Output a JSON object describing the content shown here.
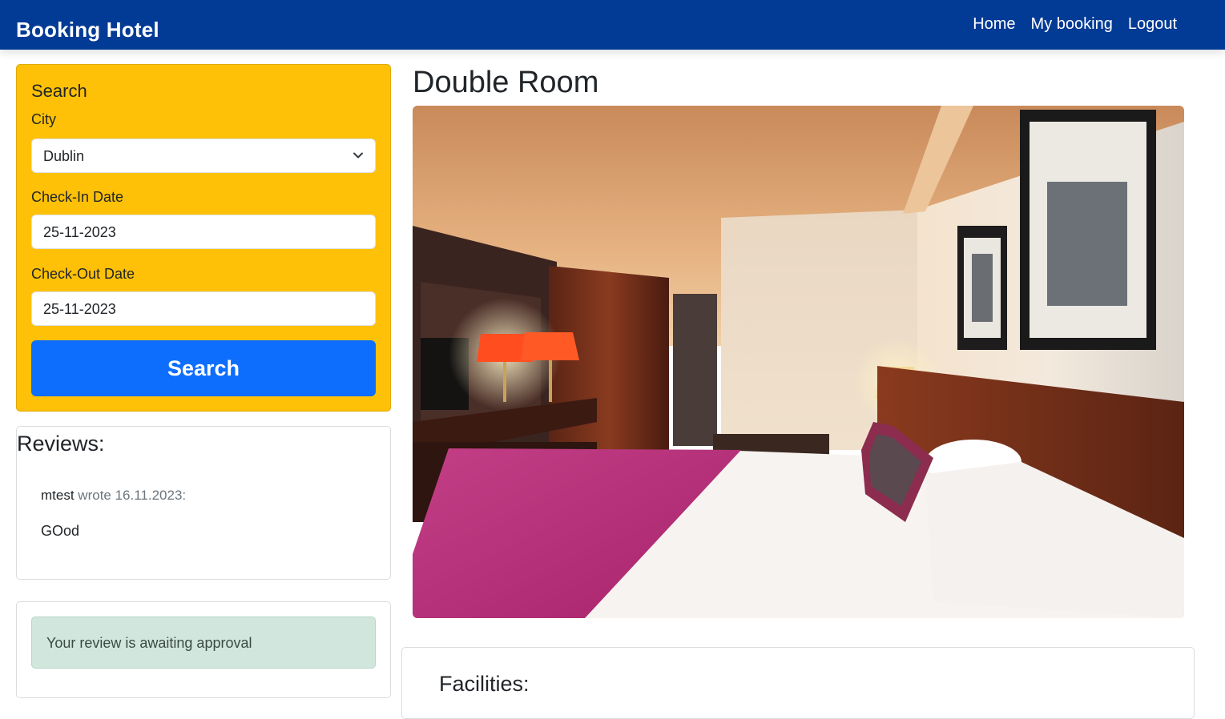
{
  "navbar": {
    "brand": "Booking Hotel",
    "links": [
      "Home",
      "My booking",
      "Logout"
    ],
    "background": "#023b95"
  },
  "search": {
    "title": "Search",
    "city_label": "City",
    "city_value": "Dublin",
    "checkin_label": "Check-In Date",
    "checkin_value": "25-11-2023",
    "checkout_label": "Check-Out Date",
    "checkout_value": "25-11-2023",
    "button_label": "Search",
    "panel_color": "#ffc107",
    "button_color": "#0d6efd"
  },
  "reviews": {
    "title": "Reviews:",
    "items": [
      {
        "user": "mtest",
        "wrote": "wrote 16.11.2023:",
        "text": "GOod"
      }
    ]
  },
  "approval": {
    "message": "Your review is awaiting approval"
  },
  "room": {
    "title": "Double Room",
    "facilities_title": "Facilities:"
  }
}
